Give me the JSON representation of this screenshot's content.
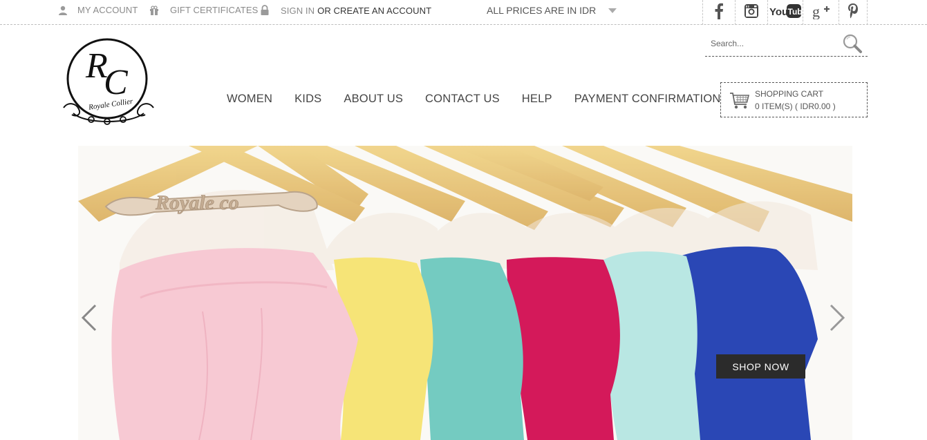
{
  "topbar": {
    "my_account": "MY ACCOUNT",
    "gift_certificates": "GIFT CERTIFICATES",
    "sign_in": "SIGN IN",
    "or_create": "OR CREATE AN ACCOUNT",
    "currency": "ALL PRICES ARE IN IDR",
    "social": [
      "facebook-icon",
      "instagram-icon",
      "youtube-icon",
      "google-plus-icon",
      "pinterest-icon"
    ]
  },
  "logo": {
    "initials": "RC",
    "name": "Royale Collier"
  },
  "search": {
    "placeholder": "Search..."
  },
  "nav": {
    "items": [
      "WOMEN",
      "KIDS",
      "ABOUT US",
      "CONTACT US",
      "HELP",
      "PAYMENT CONFIRMATION"
    ]
  },
  "cart": {
    "title": "SHOPPING CART",
    "summary": "0 ITEM(S) ( IDR0.00 )"
  },
  "hero": {
    "hanger_text": "Royale co",
    "cta": "SHOP NOW",
    "dress_colors": [
      "#f7c9d3",
      "#f6e477",
      "#74cbc1",
      "#d4195a",
      "#b9e7e3",
      "#2a47b5"
    ]
  }
}
